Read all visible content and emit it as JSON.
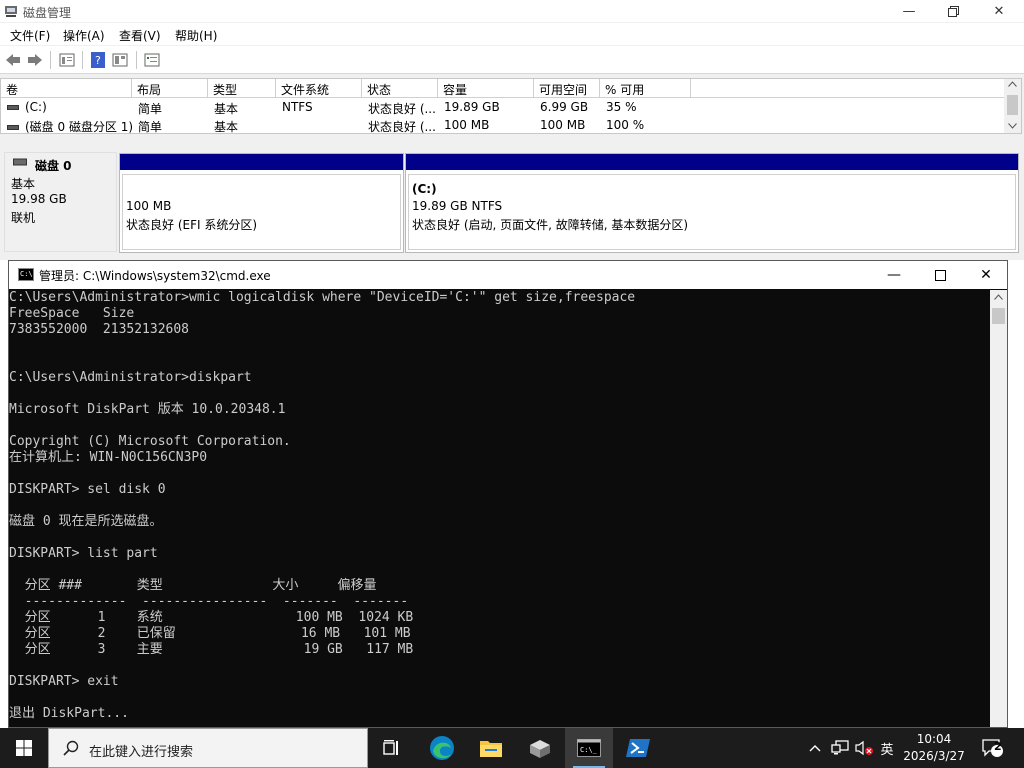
{
  "disk_mgmt": {
    "title": "磁盘管理",
    "menu": [
      "文件(F)",
      "操作(A)",
      "查看(V)",
      "帮助(H)"
    ],
    "columns": [
      "卷",
      "布局",
      "类型",
      "文件系统",
      "状态",
      "容量",
      "可用空间",
      "% 可用"
    ],
    "volumes": [
      {
        "name": "(C:)",
        "layout": "简单",
        "type": "基本",
        "fs": "NTFS",
        "status": "状态良好 (...",
        "capacity": "19.89 GB",
        "free": "6.99 GB",
        "pct": "35 %"
      },
      {
        "name": "(磁盘 0 磁盘分区 1)",
        "layout": "简单",
        "type": "基本",
        "fs": "",
        "status": "状态良好 (...",
        "capacity": "100 MB",
        "free": "100 MB",
        "pct": "100 %"
      }
    ],
    "disk": {
      "name": "磁盘 0",
      "kind": "基本",
      "size": "19.98 GB",
      "state": "联机"
    },
    "partitions": [
      {
        "label": "",
        "size": "100 MB",
        "status": "状态良好 (EFI 系统分区)"
      },
      {
        "label": "(C:)",
        "size": "19.89 GB NTFS",
        "status": "状态良好 (启动, 页面文件, 故障转储, 基本数据分区)"
      }
    ]
  },
  "cmd": {
    "title": "管理员: C:\\Windows\\system32\\cmd.exe",
    "lines": [
      "C:\\Users\\Administrator>wmic logicaldisk where \"DeviceID='C:'\" get size,freespace",
      "FreeSpace   Size",
      "7383552000  21352132608",
      "",
      "",
      "C:\\Users\\Administrator>diskpart",
      "",
      "Microsoft DiskPart 版本 10.0.20348.1",
      "",
      "Copyright (C) Microsoft Corporation.",
      "在计算机上: WIN-N0C156CN3P0",
      "",
      "DISKPART> sel disk 0",
      "",
      "磁盘 0 现在是所选磁盘。",
      "",
      "DISKPART> list part",
      "",
      "  分区 ###       类型              大小     偏移量",
      "  -------------  ----------------  -------  -------",
      "  分区      1    系统                 100 MB  1024 KB",
      "  分区      2    已保留                16 MB   101 MB",
      "  分区      3    主要                  19 GB   117 MB",
      "",
      "DISKPART> exit",
      "",
      "退出 DiskPart..."
    ]
  },
  "taskbar": {
    "search_placeholder": "在此键入进行搜索",
    "ime": "英",
    "time": "10:04",
    "date": "2026/3/27",
    "notification_count": "2"
  }
}
